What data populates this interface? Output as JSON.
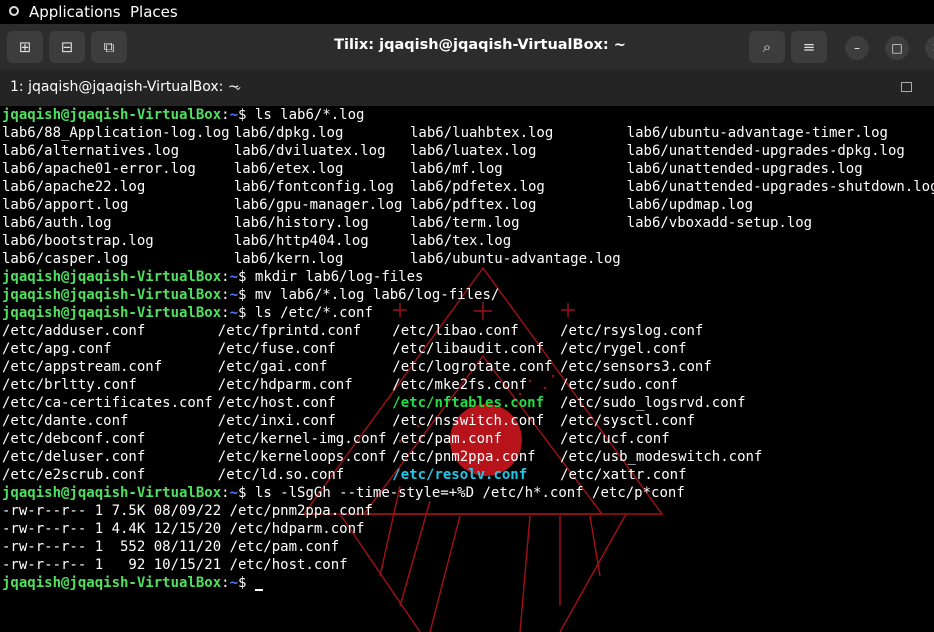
{
  "topbar": {
    "applications": "Applications",
    "places": "Places"
  },
  "titlebar": {
    "title": "Tilix: jqaqish@jqaqish-VirtualBox: ~",
    "add_terminal_right_icon": "⊞",
    "add_terminal_down_icon": "⊟",
    "session_icon": "⧉",
    "search_icon": "⌕",
    "menu_icon": "≡",
    "minimize_icon": "–",
    "maximize_icon": "□",
    "close_icon": "✕"
  },
  "tab": {
    "label": "1: jqaqish@jqaqish-VirtualBox: ~",
    "chevron": "⌄"
  },
  "colors": {
    "user": "#4ee05e",
    "path": "#4f7dff",
    "green_file": "#22dd44",
    "cyan_file": "#22c8e8",
    "watermark": "#c0141c"
  },
  "prompt": {
    "user": "jqaqish@jqaqish-VirtualBox",
    "sep": ":",
    "path": "~",
    "dollar": "$ "
  },
  "lines": [
    {
      "kind": "prompt",
      "cmd": "ls lab6/*.log"
    },
    {
      "kind": "cols",
      "cells": [
        "lab6/88_Application-log.log",
        "lab6/dpkg.log",
        "lab6/luahbtex.log",
        "lab6/ubuntu-advantage-timer.log"
      ]
    },
    {
      "kind": "cols",
      "cells": [
        "lab6/alternatives.log",
        "lab6/dviluatex.log",
        "lab6/luatex.log",
        "lab6/unattended-upgrades-dpkg.log"
      ]
    },
    {
      "kind": "cols",
      "cells": [
        "lab6/apache01-error.log",
        "lab6/etex.log",
        "lab6/mf.log",
        "lab6/unattended-upgrades.log"
      ]
    },
    {
      "kind": "cols",
      "cells": [
        "lab6/apache22.log",
        "lab6/fontconfig.log",
        "lab6/pdfetex.log",
        "lab6/unattended-upgrades-shutdown.log"
      ]
    },
    {
      "kind": "cols",
      "cells": [
        "lab6/apport.log",
        "lab6/gpu-manager.log",
        "lab6/pdftex.log",
        "lab6/updmap.log"
      ]
    },
    {
      "kind": "cols",
      "cells": [
        "lab6/auth.log",
        "lab6/history.log",
        "lab6/term.log",
        "lab6/vboxadd-setup.log"
      ]
    },
    {
      "kind": "cols",
      "cells": [
        "lab6/bootstrap.log",
        "lab6/http404.log",
        "lab6/tex.log",
        ""
      ]
    },
    {
      "kind": "cols",
      "cells": [
        "lab6/casper.log",
        "lab6/kern.log",
        "lab6/ubuntu-advantage.log",
        ""
      ]
    },
    {
      "kind": "prompt",
      "cmd": "mkdir lab6/log-files"
    },
    {
      "kind": "prompt",
      "cmd": "mv lab6/*.log lab6/log-files/"
    },
    {
      "kind": "prompt",
      "cmd": "ls /etc/*.conf"
    },
    {
      "kind": "cols2",
      "cells": [
        "/etc/adduser.conf",
        "/etc/fprintd.conf",
        "/etc/libao.conf",
        "/etc/rsyslog.conf"
      ]
    },
    {
      "kind": "cols2",
      "cells": [
        "/etc/apg.conf",
        "/etc/fuse.conf",
        "/etc/libaudit.conf",
        "/etc/rygel.conf"
      ]
    },
    {
      "kind": "cols2",
      "cells": [
        "/etc/appstream.conf",
        "/etc/gai.conf",
        "/etc/logrotate.conf",
        "/etc/sensors3.conf"
      ]
    },
    {
      "kind": "cols2",
      "cells": [
        "/etc/brltty.conf",
        "/etc/hdparm.conf",
        "/etc/mke2fs.conf",
        "/etc/sudo.conf"
      ]
    },
    {
      "kind": "cols2",
      "cells": [
        "/etc/ca-certificates.conf",
        "/etc/host.conf",
        "/etc/nftables.conf",
        "/etc/sudo_logsrvd.conf"
      ],
      "hl": 2,
      "hlc": "green"
    },
    {
      "kind": "cols2",
      "cells": [
        "/etc/dante.conf",
        "/etc/inxi.conf",
        "/etc/nsswitch.conf",
        "/etc/sysctl.conf"
      ]
    },
    {
      "kind": "cols2",
      "cells": [
        "/etc/debconf.conf",
        "/etc/kernel-img.conf",
        "/etc/pam.conf",
        "/etc/ucf.conf"
      ]
    },
    {
      "kind": "cols2",
      "cells": [
        "/etc/deluser.conf",
        "/etc/kerneloops.conf",
        "/etc/pnm2ppa.conf",
        "/etc/usb_modeswitch.conf"
      ]
    },
    {
      "kind": "cols2",
      "cells": [
        "/etc/e2scrub.conf",
        "/etc/ld.so.conf",
        "/etc/resolv.conf",
        "/etc/xattr.conf"
      ],
      "hl": 2,
      "hlc": "cyan"
    },
    {
      "kind": "prompt",
      "cmd": "ls -lSgGh --time-style=+%D /etc/h*.conf /etc/p*conf"
    },
    {
      "kind": "text",
      "text": "-rw-r--r-- 1 7.5K 08/09/22 /etc/pnm2ppa.conf"
    },
    {
      "kind": "text",
      "text": "-rw-r--r-- 1 4.4K 12/15/20 /etc/hdparm.conf"
    },
    {
      "kind": "text",
      "text": "-rw-r--r-- 1  552 08/11/20 /etc/pam.conf"
    },
    {
      "kind": "text",
      "text": "-rw-r--r-- 1   92 10/15/21 /etc/host.conf"
    },
    {
      "kind": "prompt",
      "cmd": ""
    }
  ]
}
